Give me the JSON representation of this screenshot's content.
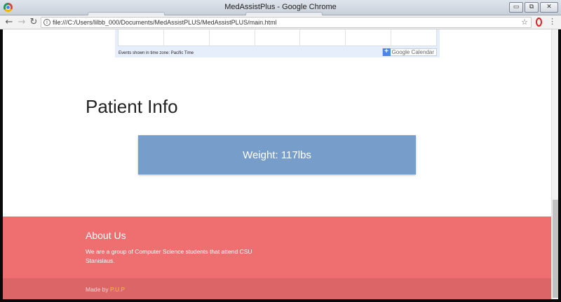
{
  "window": {
    "title": "MedAssistPlus - Google Chrome",
    "minimize_glyph": "▭",
    "restore_glyph": "⧉",
    "close_glyph": "✕"
  },
  "toolbar": {
    "back_glyph": "←",
    "forward_glyph": "→",
    "reload_glyph": "↻",
    "info_glyph": "i",
    "url": "file:///C:/Users/lilbb_000/Documents/MedAssistPLUS/MedAssistPLUS/main.html",
    "star_glyph": "☆",
    "menu_glyph": "⋮"
  },
  "calendar": {
    "timezone_note": "Events shown in time zone: Pacific Time",
    "badge_plus": "+",
    "badge_label": "Google Calendar"
  },
  "patient": {
    "section_title": "Patient Info",
    "weight_text": "Weight: 117lbs"
  },
  "footer": {
    "about_heading": "About Us",
    "about_text": "We are a group of Computer Science students that attend CSU Stanislaus.",
    "made_by_prefix": "Made by ",
    "made_by_link": "P.U.P"
  },
  "colors": {
    "weight_card": "#779ecb",
    "footer": "#ef6f71",
    "footer_bottom": "#dc6568",
    "link": "#f6c341"
  }
}
